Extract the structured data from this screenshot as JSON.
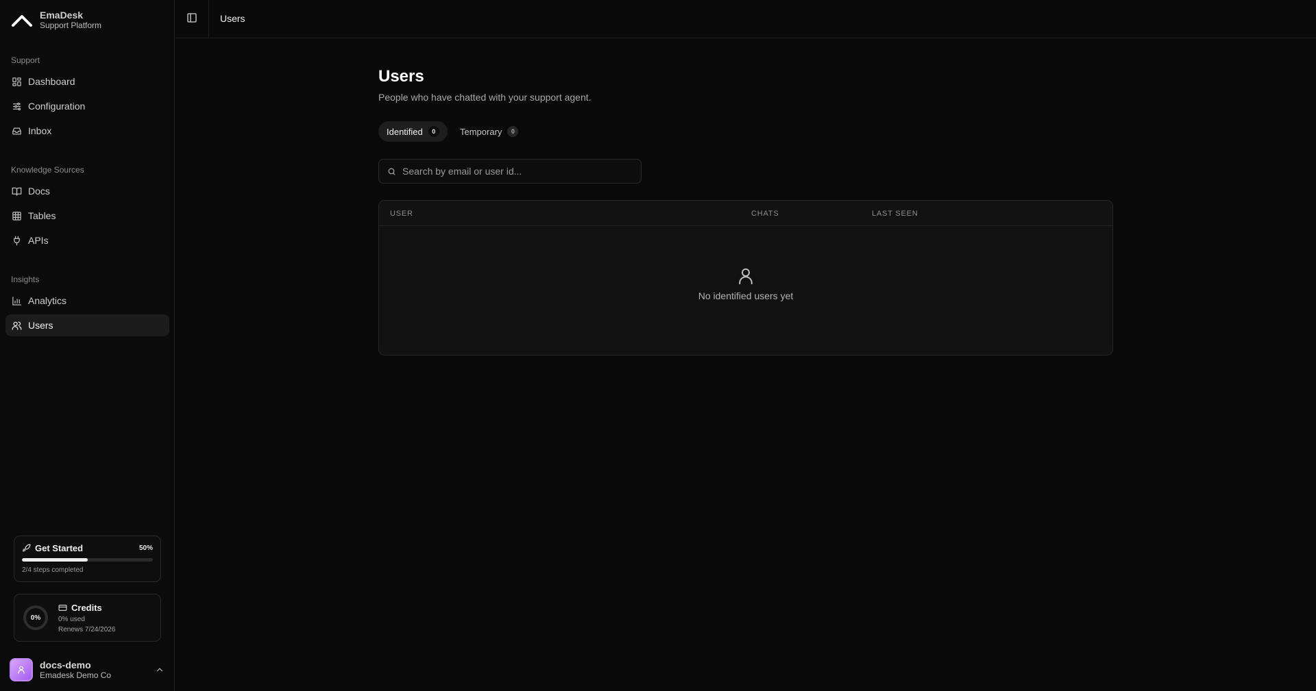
{
  "brand": {
    "name": "EmaDesk",
    "subtitle": "Support Platform"
  },
  "sidebar": {
    "sections": [
      {
        "label": "Support",
        "items": [
          {
            "label": "Dashboard",
            "icon": "dashboard-icon"
          },
          {
            "label": "Configuration",
            "icon": "sliders-icon"
          },
          {
            "label": "Inbox",
            "icon": "inbox-icon"
          }
        ]
      },
      {
        "label": "Knowledge Sources",
        "items": [
          {
            "label": "Docs",
            "icon": "book-icon"
          },
          {
            "label": "Tables",
            "icon": "table-icon"
          },
          {
            "label": "APIs",
            "icon": "plug-icon"
          }
        ]
      },
      {
        "label": "Insights",
        "items": [
          {
            "label": "Analytics",
            "icon": "bar-chart-icon"
          },
          {
            "label": "Users",
            "icon": "users-icon",
            "active": true
          }
        ]
      }
    ],
    "get_started": {
      "title": "Get Started",
      "percent_label": "50%",
      "progress": 0.5,
      "steps": "2/4 steps completed"
    },
    "credits": {
      "title": "Credits",
      "ring_label": "0%",
      "used": "0% used",
      "renews": "Renews 7/24/2026",
      "usage": 0
    },
    "user": {
      "name": "docs-demo",
      "org": "Emadesk Demo Co"
    }
  },
  "topbar": {
    "breadcrumb": "Users"
  },
  "main": {
    "title": "Users",
    "subtitle": "People who have chatted with your support agent.",
    "tabs": [
      {
        "label": "Identified",
        "count": "0",
        "active": true
      },
      {
        "label": "Temporary",
        "count": "0",
        "active": false
      }
    ],
    "search": {
      "placeholder": "Search by email or user id...",
      "value": ""
    },
    "table": {
      "columns": [
        "User",
        "Chats",
        "Last Seen"
      ],
      "rows": [],
      "empty_text": "No identified users yet"
    }
  },
  "colors": {
    "background": "#0a0a0a",
    "panel": "#111111",
    "border": "#262626",
    "accent_avatar": "#b57cf3"
  }
}
